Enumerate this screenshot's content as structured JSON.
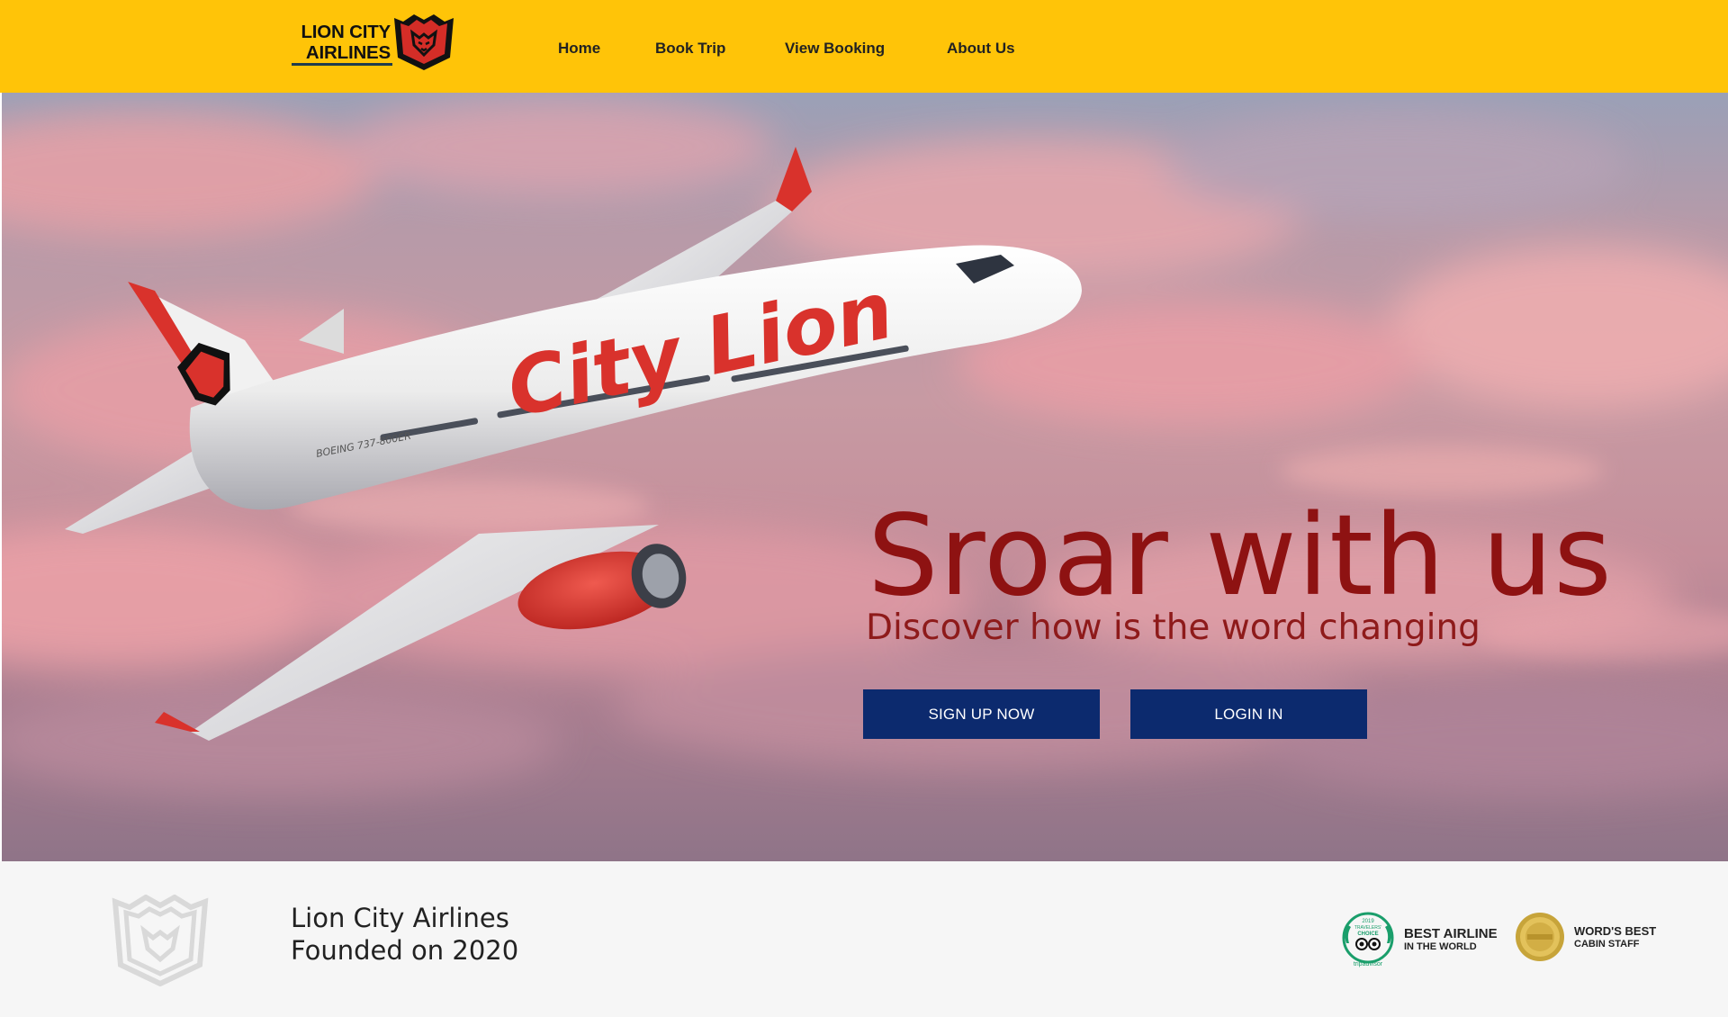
{
  "colors": {
    "header_bg": "#ffc408",
    "button_bg": "#0c2a6e",
    "headline": "#8e1212",
    "plane_livery_red": "#d9322c",
    "footer_bg": "#f6f6f6"
  },
  "header": {
    "logo": {
      "line1": "LION CITY",
      "line2": "AIRLINES",
      "emblem_icon": "lion-shield-icon"
    },
    "nav": [
      {
        "label": "Home"
      },
      {
        "label": "Book Trip"
      },
      {
        "label": "View Booking"
      },
      {
        "label": "About Us"
      }
    ]
  },
  "hero": {
    "plane_livery_text": "City Lion",
    "plane_model_text": "BOEING 737-800ER",
    "headline": "Sroar with us",
    "subheadline": "Discover how is the word changing",
    "buttons": {
      "signup": "SIGN UP NOW",
      "login": "LOGIN IN"
    }
  },
  "footer": {
    "company_name": "Lion City Airlines",
    "founded": "Founded on 2020",
    "awards": [
      {
        "icon": "tripadvisor-travelers-choice-icon",
        "badge_year": "2019",
        "badge_line1": "TRAVELERS'",
        "badge_line2": "CHOICE",
        "badge_brand": "tripadvisor",
        "title": "BEST AIRLINE",
        "subtitle": "IN THE WORLD"
      },
      {
        "icon": "skytrax-award-icon",
        "title": "WORD'S BEST",
        "subtitle": "CABIN STAFF"
      }
    ]
  }
}
